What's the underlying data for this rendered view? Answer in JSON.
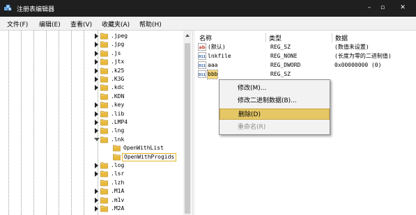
{
  "window": {
    "title": "注册表编辑器",
    "controls": {
      "minimize": "–",
      "maximize": "▫",
      "close": "✕"
    }
  },
  "menubar": {
    "items": [
      "文件(F)",
      "编辑(E)",
      "查看(V)",
      "收藏夹(A)",
      "帮助(H)"
    ]
  },
  "tree": {
    "items": [
      {
        "label": ".jpeg",
        "expander": "collapsed"
      },
      {
        "label": ".jpg",
        "expander": "collapsed"
      },
      {
        "label": ".js",
        "expander": "collapsed"
      },
      {
        "label": ".jtx",
        "expander": "collapsed"
      },
      {
        "label": ".k25",
        "expander": "collapsed"
      },
      {
        "label": ".K3G",
        "expander": "collapsed"
      },
      {
        "label": ".kdc",
        "expander": "collapsed"
      },
      {
        "label": ".KDN",
        "expander": "none"
      },
      {
        "label": ".key",
        "expander": "collapsed"
      },
      {
        "label": ".lib",
        "expander": "collapsed"
      },
      {
        "label": ".LMP4",
        "expander": "collapsed"
      },
      {
        "label": ".lng",
        "expander": "collapsed"
      },
      {
        "label": ".lnk",
        "expander": "expanded"
      },
      {
        "label": "OpenWithList",
        "expander": "none",
        "child": true
      },
      {
        "label": "OpenWithProgids",
        "expander": "none",
        "child": true,
        "selected": true
      },
      {
        "label": ".log",
        "expander": "collapsed"
      },
      {
        "label": ".lsr",
        "expander": "collapsed"
      },
      {
        "label": ".lzh",
        "expander": "none"
      },
      {
        "label": ".M1A",
        "expander": "collapsed"
      },
      {
        "label": ".m1v",
        "expander": "collapsed"
      },
      {
        "label": ".M2A",
        "expander": "collapsed"
      }
    ]
  },
  "list": {
    "columns": {
      "name": "名称",
      "type": "类型",
      "data": "数据"
    },
    "rows": [
      {
        "name": "(默认)",
        "type": "REG_SZ",
        "data": "(数值未设置)",
        "icon": "string-value-icon"
      },
      {
        "name": "lnkfile",
        "type": "REG_NONE",
        "data": "(长度为零的二进制值)",
        "icon": "binary-value-icon"
      },
      {
        "name": "aaa",
        "type": "REG_DWORD",
        "data": "0x00000000 (0)",
        "icon": "binary-value-icon"
      },
      {
        "name": "bbb",
        "type": "REG_SZ",
        "data": "",
        "icon": "binary-value-icon",
        "selected": true
      }
    ]
  },
  "context_menu": {
    "items": [
      {
        "label": "修改(M)...",
        "state": "normal"
      },
      {
        "label": "修改二进制数据(B)...",
        "state": "normal"
      },
      {
        "label": "删除(D)",
        "state": "highlighted"
      },
      {
        "label": "重命名(R)",
        "state": "disabled"
      }
    ]
  },
  "colors": {
    "titlebar": "#1f1f1f",
    "folder": "#e8b93a",
    "highlight": "#e5c766"
  }
}
